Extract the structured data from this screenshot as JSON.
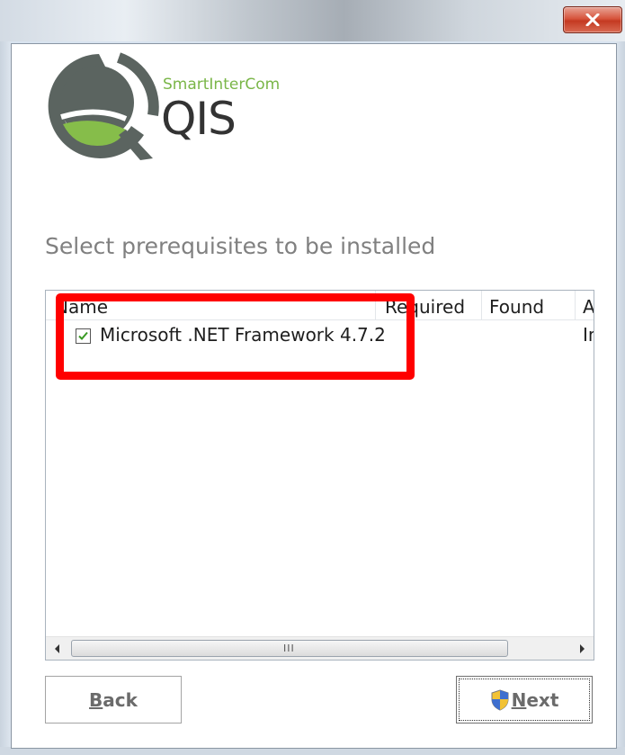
{
  "window": {
    "close_icon": "close-icon"
  },
  "brand": {
    "small": "SmartInterCom",
    "big": "QIS"
  },
  "heading": "Select prerequisites to be installed",
  "list": {
    "columns": [
      "Name",
      "Required",
      "Found",
      "A"
    ],
    "rows": [
      {
        "checked": true,
        "name": "Microsoft .NET Framework 4.7.2",
        "required": "",
        "found": "",
        "action": "In"
      }
    ],
    "scrollbar": {
      "left_icon": "scroll-left-icon",
      "right_icon": "scroll-right-icon",
      "grip": "III"
    }
  },
  "buttons": {
    "back_first": "B",
    "back_rest": "ack",
    "next_first": "N",
    "next_rest": "ext"
  },
  "colors": {
    "highlight": "#ff0000",
    "brand_green": "#7ab648",
    "logo_gray": "#5b6460"
  }
}
